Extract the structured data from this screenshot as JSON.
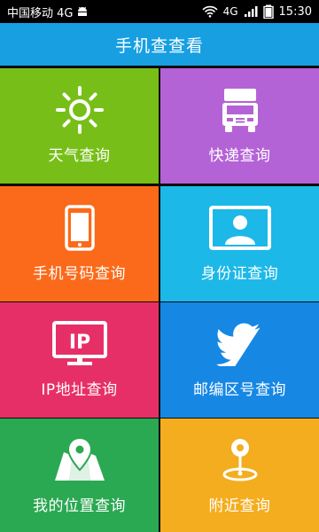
{
  "status_bar": {
    "carrier": "中国移动 4G",
    "network_small": "4G",
    "time": "15:30"
  },
  "app_bar": {
    "title": "手机查查看"
  },
  "tiles": [
    {
      "label": "天气查询",
      "icon": "sun-icon",
      "color": "#77bf18"
    },
    {
      "label": "快递查询",
      "icon": "truck-icon",
      "color": "#b463d6"
    },
    {
      "label": "手机号码查询",
      "icon": "phone-icon",
      "color": "#fb6a1a"
    },
    {
      "label": "身份证查询",
      "icon": "id-card-icon",
      "color": "#1cb8e8"
    },
    {
      "label": "IP地址查询",
      "icon": "monitor-ip-icon",
      "color": "#e72f67"
    },
    {
      "label": "邮编区号查询",
      "icon": "twitter-bird-icon",
      "color": "#1787e4"
    },
    {
      "label": "我的位置查询",
      "icon": "map-pin-icon",
      "color": "#2ba852"
    },
    {
      "label": "附近查询",
      "icon": "location-target-icon",
      "color": "#f4ad1e"
    }
  ]
}
